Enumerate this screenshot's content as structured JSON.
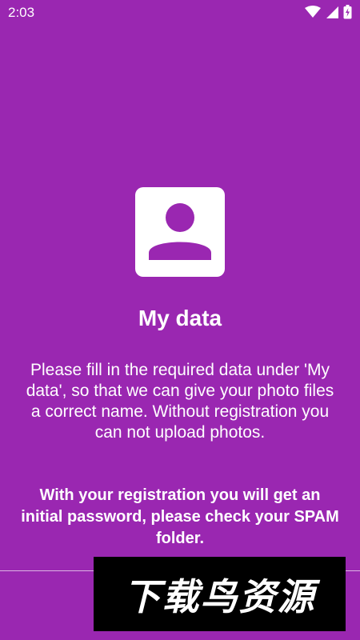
{
  "status_bar": {
    "time": "2:03",
    "icons": [
      "wifi-icon",
      "signal-icon",
      "battery-icon"
    ]
  },
  "profile_icon": "person-icon",
  "title": "My data",
  "description": "Please fill in the required data under 'My data', so that we can give your photo files a correct name. Without registration you can not upload photos.",
  "notice": "With your registration you will get an initial password, please check your SPAM folder.",
  "watermark": "下载鸟资源",
  "colors": {
    "background": "#9a27b1",
    "text": "#ffffff",
    "card": "#ffffff",
    "icon": "#9a27b1",
    "watermark_bg": "#000000"
  }
}
